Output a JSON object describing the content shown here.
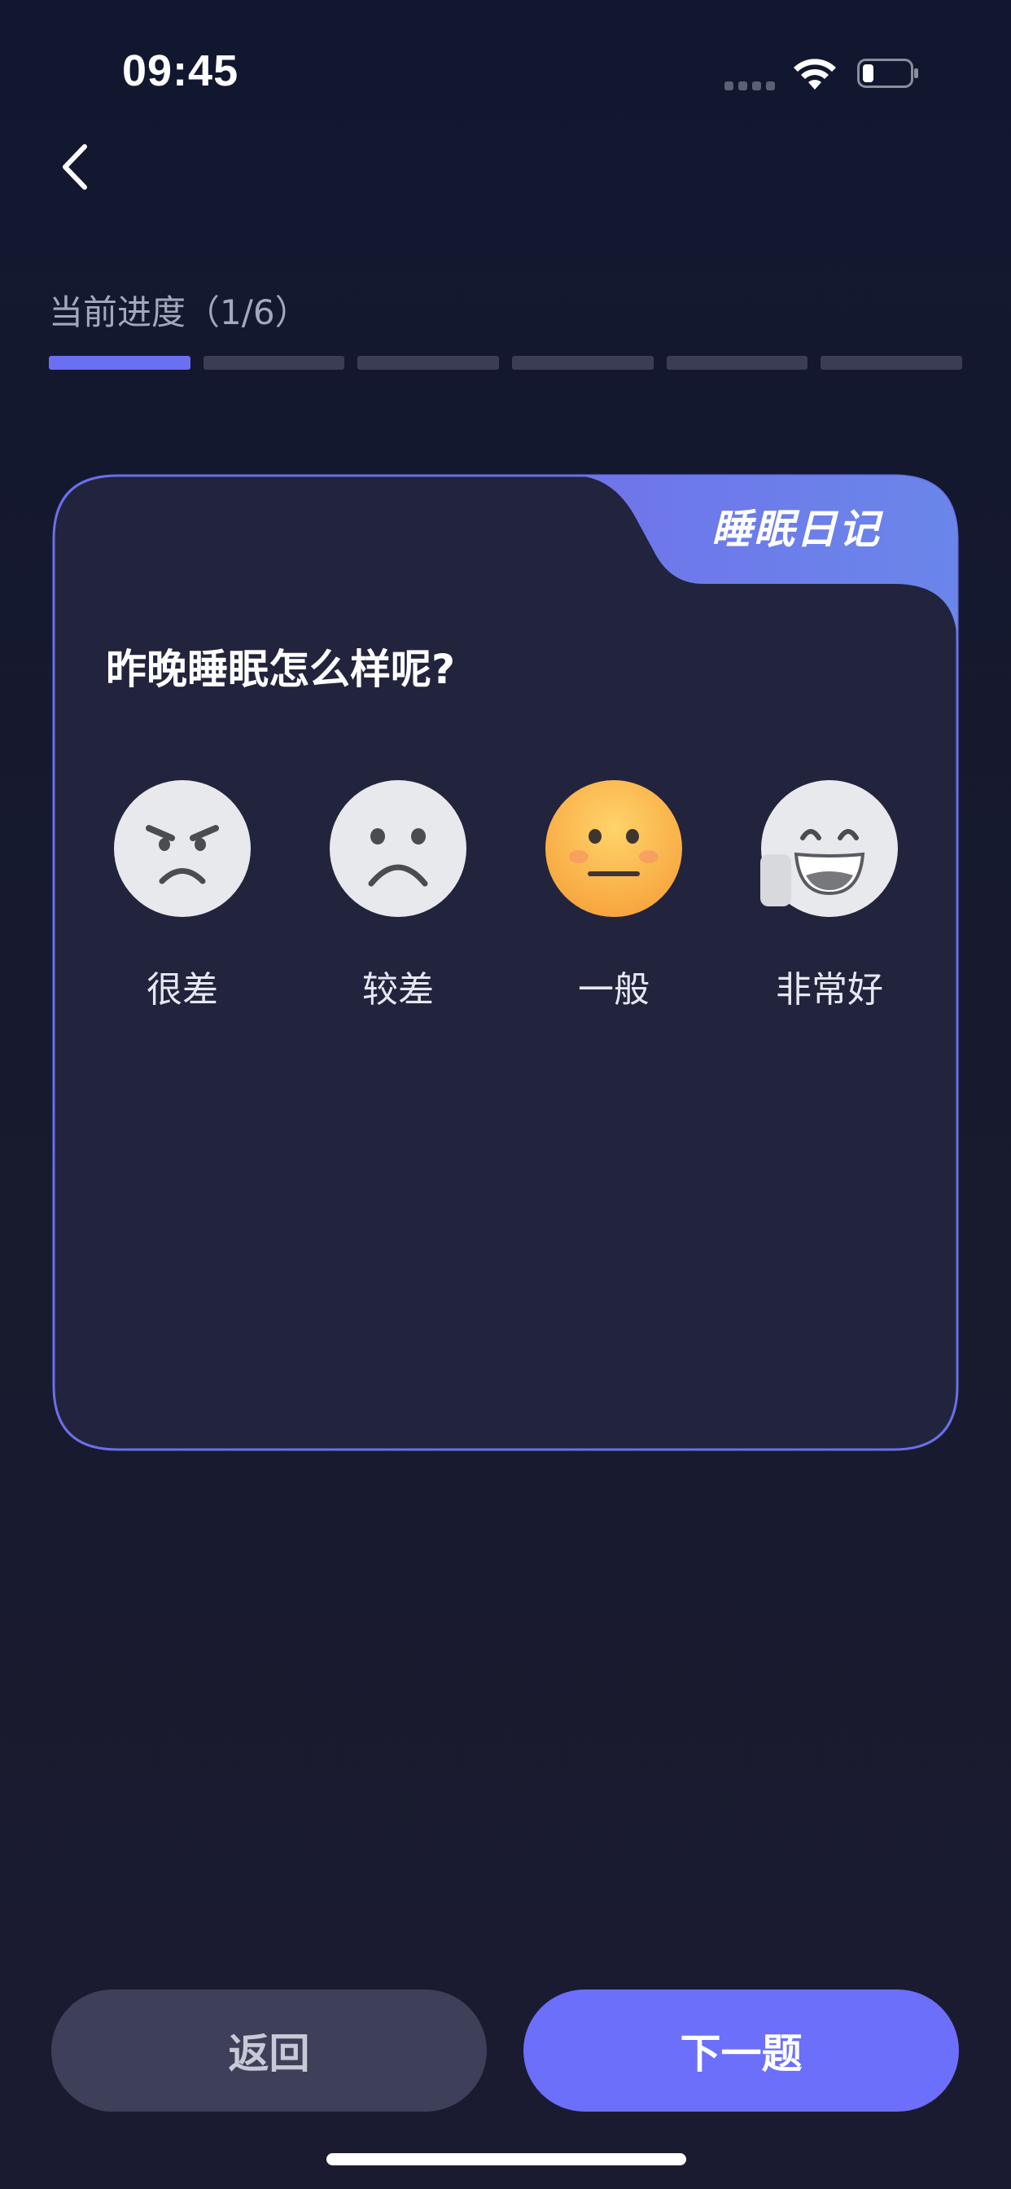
{
  "status_bar": {
    "time": "09:45"
  },
  "progress": {
    "label": "当前进度（1/6）",
    "current": 1,
    "total": 6
  },
  "card": {
    "tag": "睡眠日记",
    "question": "昨晚睡眠怎么样呢?",
    "options": [
      {
        "label": "很差",
        "icon": "angry-face-icon",
        "selected": false
      },
      {
        "label": "较差",
        "icon": "sad-face-icon",
        "selected": false
      },
      {
        "label": "一般",
        "icon": "neutral-face-icon",
        "selected": true
      },
      {
        "label": "非常好",
        "icon": "grinning-face-icon",
        "selected": false
      }
    ]
  },
  "buttons": {
    "back_label": "返回",
    "next_label": "下一题"
  },
  "colors": {
    "accent": "#6b6ff9",
    "background": "#161a2e",
    "card": "#22243d",
    "selected_face": "#f9b13c",
    "unselected_face": "#e8e9ec"
  }
}
